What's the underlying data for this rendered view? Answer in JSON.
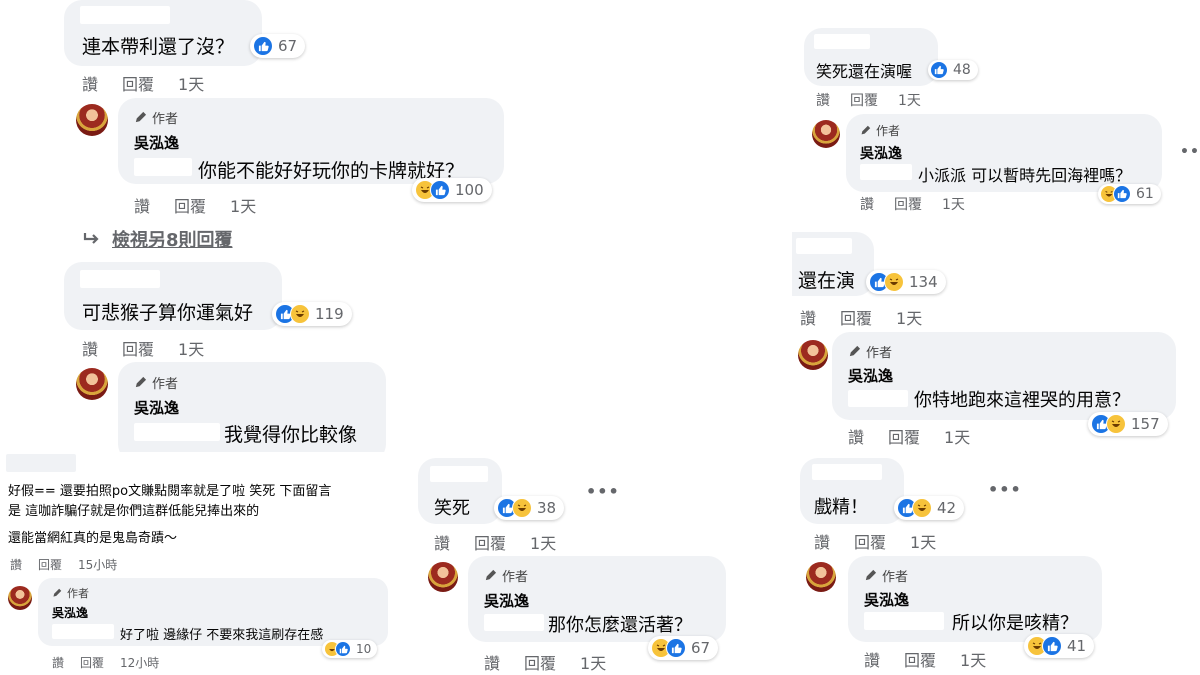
{
  "labels": {
    "read": "讚",
    "reply": "回覆",
    "author": "作者"
  },
  "author_name": "吳泓逸",
  "icons": {
    "like": "thumbs-up-icon",
    "haha": "laughing-face-icon",
    "author": "pencil-icon",
    "reply_arrow": "reply-arrow-icon",
    "more": "more-options-icon"
  },
  "colors": {
    "like": "#1b74e4",
    "haha": "#f7c33b",
    "bubble": "#f0f2f5",
    "muted": "#65676b"
  },
  "p1": {
    "c1": {
      "text": "連本帶利還了沒？",
      "reactions": "67",
      "time": "1天"
    },
    "r1": {
      "text": "你能不能好好玩你的卡牌就好？",
      "reactions": "100",
      "time": "1天"
    },
    "view_more": "檢視另8則回覆",
    "c2": {
      "text": "可悲猴子算你運氣好",
      "reactions": "119",
      "time": "1天"
    },
    "r2": {
      "text": "我覺得你比較像"
    }
  },
  "p2": {
    "line1": "好假== 還要拍照po文賺點閱率就是了啦 笑死 下面留言",
    "line2": "是 這咖詐騙仔就是你們這群低能兒捧出來的",
    "line3": "還能當網紅真的是鬼島奇蹟～",
    "time": "15小時",
    "reply": {
      "text": "好了啦 邊緣仔 不要來我這刷存在感",
      "reactions": "10",
      "time": "12小時"
    }
  },
  "p3": {
    "comment": {
      "text": "笑死",
      "reactions": "38",
      "time": "1天"
    },
    "reply": {
      "text": "那你怎麼還活著？",
      "reactions": "67",
      "time": "1天"
    }
  },
  "p4": {
    "c1": {
      "text": "笑死還在演喔",
      "reactions": "48",
      "time": "1天"
    },
    "r1": {
      "text": "小派派 可以暫時先回海裡嗎？",
      "reactions": "61",
      "time": "1天"
    },
    "c2": {
      "text": "還在演",
      "reactions": "134",
      "time": "1天"
    },
    "r2": {
      "text": "你特地跑來這裡哭的用意？",
      "reactions": "157",
      "time": "1天"
    }
  },
  "p5": {
    "comment": {
      "text": "戲精！",
      "reactions": "42",
      "time": "1天"
    },
    "reply": {
      "text": "所以你是咳精？",
      "reactions": "41",
      "time": "1天"
    }
  }
}
